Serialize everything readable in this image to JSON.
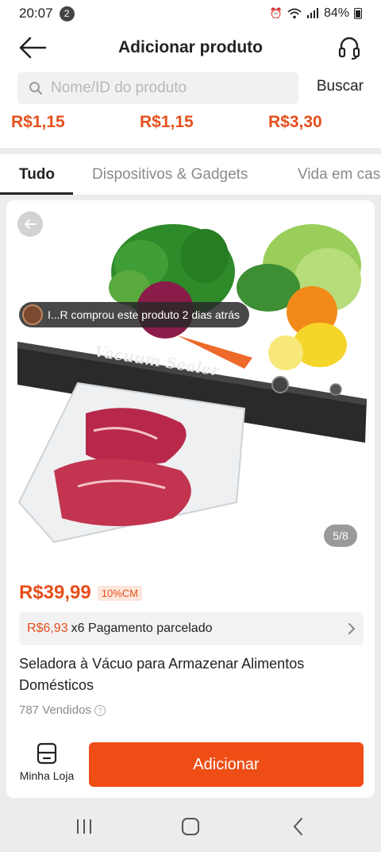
{
  "status_bar": {
    "time": "20:07",
    "notification_count": "2",
    "battery": "84%"
  },
  "header": {
    "title": "Adicionar produto"
  },
  "search": {
    "placeholder": "Nome/ID do produto",
    "button": "Buscar"
  },
  "price_strip": [
    "R$1,15",
    "R$1,15",
    "R$3,30"
  ],
  "tabs": [
    {
      "label": "Tudo",
      "active": true
    },
    {
      "label": "Dispositivos & Gadgets",
      "active": false
    },
    {
      "label": "Vida em cas",
      "active": false
    }
  ],
  "product": {
    "buyer_notice": "I...R comprou este produto 2 dias atrás",
    "image_text": "Vacuum Sealer",
    "image_counter": "5/8",
    "price": "R$39,99",
    "discount": "10%CM",
    "installment_amount": "R$6,93",
    "installment_text": "x6 Pagamento parcelado",
    "title": "Seladora à Vácuo para Armazenar Alimentos Domésticos",
    "sold": "787 Vendidos"
  },
  "bottom": {
    "store_label": "Minha Loja",
    "add_button": "Adicionar"
  },
  "colors": {
    "accent": "#ee4d16",
    "price": "#e6501c"
  },
  "icons": [
    "back-arrow-icon",
    "headset-icon",
    "search-icon",
    "chevron-right-icon",
    "store-icon",
    "help-icon"
  ]
}
